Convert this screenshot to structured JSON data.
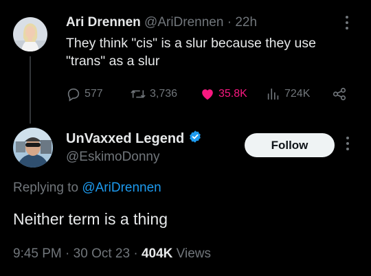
{
  "parent_tweet": {
    "display_name": "Ari Drennen",
    "handle": "@AriDrennen",
    "separator": "·",
    "time_ago": "22h",
    "text_line1": "They think \"cis\" is a slur because they use",
    "text_line2": "\"trans\" as a slur",
    "replies": "577",
    "retweets": "3,736",
    "likes": "35.8K",
    "views": "724K",
    "like_color": "#f91880"
  },
  "main_tweet": {
    "display_name": "UnVaxxed Legend",
    "handle": "@EskimoDonny",
    "follow_label": "Follow",
    "replying_prefix": "Replying to",
    "replying_to": "@AriDrennen",
    "text": "Neither term is a thing",
    "time": "9:45 PM",
    "date": "30 Oct 23",
    "views_count": "404K",
    "views_label": "Views",
    "separator": "·",
    "verified_color": "#1d9bf0"
  },
  "icons": [
    "more-icon",
    "reply-icon",
    "retweet-icon",
    "heart-icon",
    "views-icon",
    "share-icon",
    "verified-badge-icon"
  ]
}
